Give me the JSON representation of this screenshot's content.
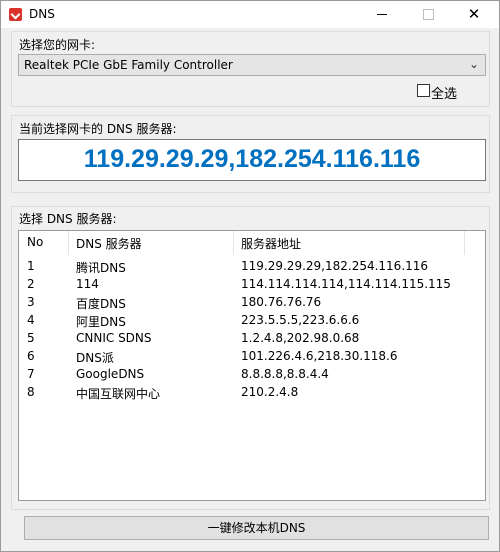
{
  "window": {
    "title": "DNS",
    "min_glyph": "—",
    "max_glyph": "□",
    "close_glyph": "✕"
  },
  "adapter": {
    "label": "选择您的网卡:",
    "selected": "Realtek PCIe GbE Family Controller",
    "dropdown_glyph": "⌄",
    "select_all": "全选",
    "select_all_checked": false
  },
  "current": {
    "label": "当前选择网卡的 DNS 服务器:",
    "value": "119.29.29.29,182.254.116.116",
    "value_color": "#0070c0"
  },
  "servers": {
    "label": "选择 DNS 服务器:",
    "columns": [
      "No",
      "DNS 服务器",
      "服务器地址"
    ],
    "rows": [
      {
        "no": "1",
        "name": "腾讯DNS",
        "addr": "119.29.29.29,182.254.116.116"
      },
      {
        "no": "2",
        "name": "114",
        "addr": "114.114.114.114,114.114.115.115"
      },
      {
        "no": "3",
        "name": "百度DNS",
        "addr": "180.76.76.76"
      },
      {
        "no": "4",
        "name": "阿里DNS",
        "addr": "223.5.5.5,223.6.6.6"
      },
      {
        "no": "5",
        "name": "CNNIC SDNS",
        "addr": "1.2.4.8,202.98.0.68"
      },
      {
        "no": "6",
        "name": "DNS派",
        "addr": "101.226.4.6,218.30.118.6"
      },
      {
        "no": "7",
        "name": "GoogleDNS",
        "addr": "8.8.8.8,8.8.4.4"
      },
      {
        "no": "8",
        "name": "中国互联网中心",
        "addr": "210.2.4.8"
      }
    ]
  },
  "apply_button": "一键修改本机DNS",
  "icons": {
    "app": "app-logo-icon",
    "dropdown": "chevron-down-icon",
    "close": "close-icon",
    "minimize": "minimize-icon",
    "maximize": "maximize-icon"
  }
}
